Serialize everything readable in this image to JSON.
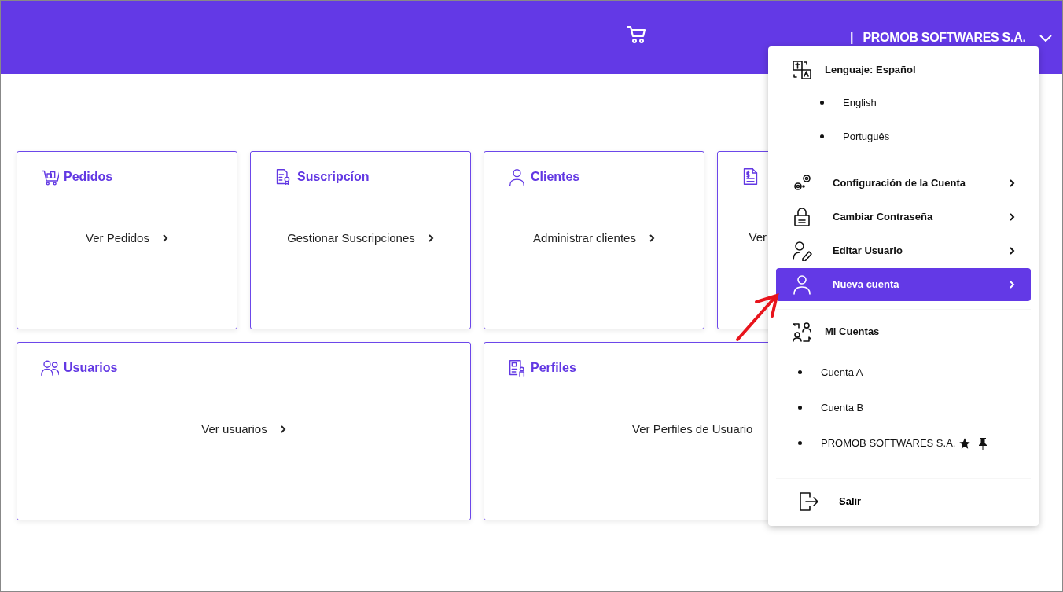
{
  "header": {
    "separator": "|",
    "company": "PROMOB SOFTWARES S.A.",
    "menu_expanded": true
  },
  "card_rows": [
    [
      {
        "kind": "cart",
        "title": "Pedidos",
        "link": "Ver Pedidos",
        "covered": false
      },
      {
        "kind": "certificate",
        "title": "Suscripcíon",
        "link": "Gestionar Suscripciones",
        "covered": false
      },
      {
        "kind": "person",
        "title": "Clientes",
        "link": "Administrar clientes",
        "covered": false
      },
      {
        "kind": "invoice",
        "link": "Ver",
        "covered": true
      }
    ],
    [
      {
        "kind": "people",
        "title": "Usuarios",
        "link": "Ver usuarios",
        "covered": false
      },
      {
        "kind": "profile",
        "title": "Perfiles",
        "link": "Ver Perfiles de Usuario",
        "covered": true
      }
    ]
  ],
  "menu": {
    "language": {
      "label": "Lenguaje: Español",
      "options": [
        "English",
        "Português"
      ]
    },
    "items": [
      {
        "kind": "gears",
        "label": "Configuración de la Cuenta",
        "selected": false
      },
      {
        "kind": "lock",
        "label": "Cambiar Contraseña",
        "selected": false
      },
      {
        "kind": "user-edit",
        "label": "Editar Usuario",
        "selected": false
      },
      {
        "kind": "person",
        "label": "Nueva cuenta",
        "selected": true
      }
    ],
    "accounts": {
      "label": "Mi Cuentas",
      "list": [
        {
          "name": "Cuenta A",
          "favorite": false,
          "pinned": false
        },
        {
          "name": "Cuenta B",
          "favorite": false,
          "pinned": false
        },
        {
          "name": "PROMOB SOFTWARES S.A.",
          "favorite": true,
          "pinned": true
        }
      ]
    },
    "logout": "Salir"
  }
}
